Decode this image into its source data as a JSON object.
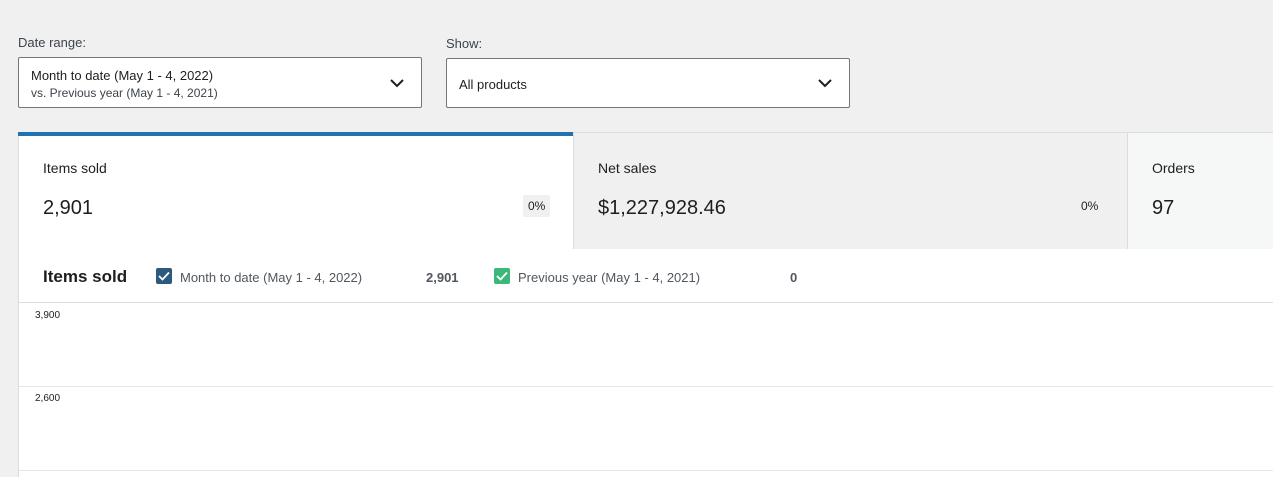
{
  "filters": {
    "date_range_label": "Date range:",
    "date_range_primary": "Month to date (May 1 - 4, 2022)",
    "date_range_secondary": "vs. Previous year (May 1 - 4, 2021)",
    "show_label": "Show:",
    "show_value": "All products"
  },
  "summary": [
    {
      "label": "Items sold",
      "value": "2,901",
      "delta": "0%"
    },
    {
      "label": "Net sales",
      "value": "$1,227,928.46",
      "delta": "0%"
    },
    {
      "label": "Orders",
      "value": "97"
    }
  ],
  "chart": {
    "title": "Items sold",
    "legend": [
      {
        "label": "Month to date (May 1 - 4, 2022)",
        "total": "2,901",
        "color": "#2c5a7e"
      },
      {
        "label": "Previous year (May 1 - 4, 2021)",
        "total": "0",
        "color": "#3cb878"
      }
    ],
    "y_ticks": [
      "3,900",
      "2,600"
    ]
  },
  "colors": {
    "accent": "#2271b1"
  }
}
